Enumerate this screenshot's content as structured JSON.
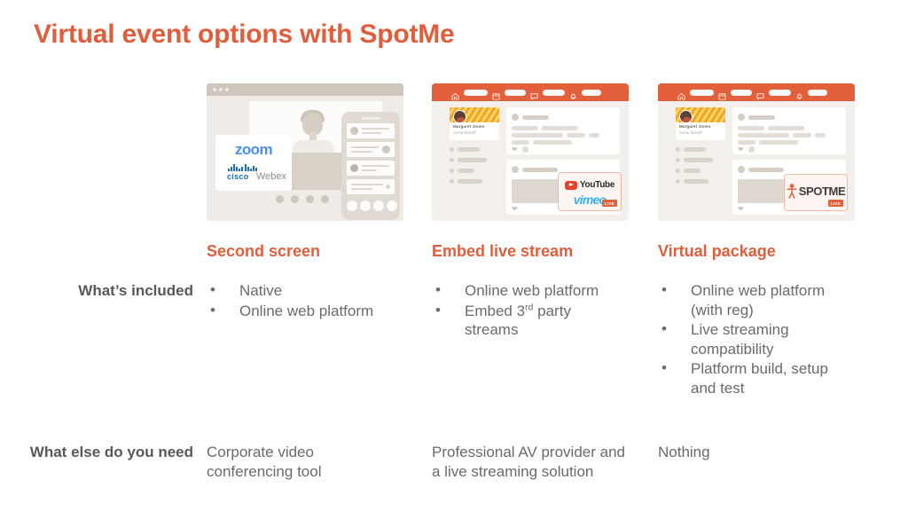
{
  "slide": {
    "title": "Virtual event options with SpotMe",
    "accent_color": "#e05e3b",
    "text_color": "#6a6a6c",
    "label_color": "#58585a",
    "background": "#ffffff"
  },
  "columns": [
    {
      "heading": "Second screen",
      "included": [
        "Native",
        "Online web platform"
      ],
      "need": "Corporate video conferencing tool"
    },
    {
      "heading": "Embed live stream",
      "included": [
        "Online web platform",
        "Embed 3rd party streams"
      ],
      "need": "Professional AV provider and a live streaming solution"
    },
    {
      "heading": "Virtual package",
      "included": [
        "Online web platform (with reg)",
        "Live streaming compatibility",
        "Platform build, setup and test"
      ],
      "need": "Nothing"
    }
  ],
  "row_labels": {
    "included": "What’s included",
    "need": "What else do you need"
  },
  "mockups": {
    "second_screen": {
      "type": "browser-with-phone",
      "logos": {
        "zoom": "zoom",
        "cisco": "cisco",
        "webex": "Webex"
      },
      "carousel_dots": 4,
      "phone_cards": 4,
      "phone_buttons": 4
    },
    "embed_live_stream": {
      "type": "spotme-web-app",
      "profile": {
        "name": "Margaret Jones",
        "event": "Acme Kickoff"
      },
      "nav_items": 4,
      "sidebar_items": 4,
      "feed_cards": 2,
      "logos": {
        "youtube": "YouTube",
        "vimeo": "vimeo",
        "live_badge": "LIVE"
      }
    },
    "virtual_package": {
      "type": "spotme-web-app",
      "profile": {
        "name": "Margaret Jones",
        "event": "Acme Kickoff"
      },
      "nav_items": 4,
      "sidebar_items": 4,
      "feed_cards": 2,
      "logos": {
        "spotme": "SPOTME",
        "live_badge": "LIVE"
      }
    }
  }
}
